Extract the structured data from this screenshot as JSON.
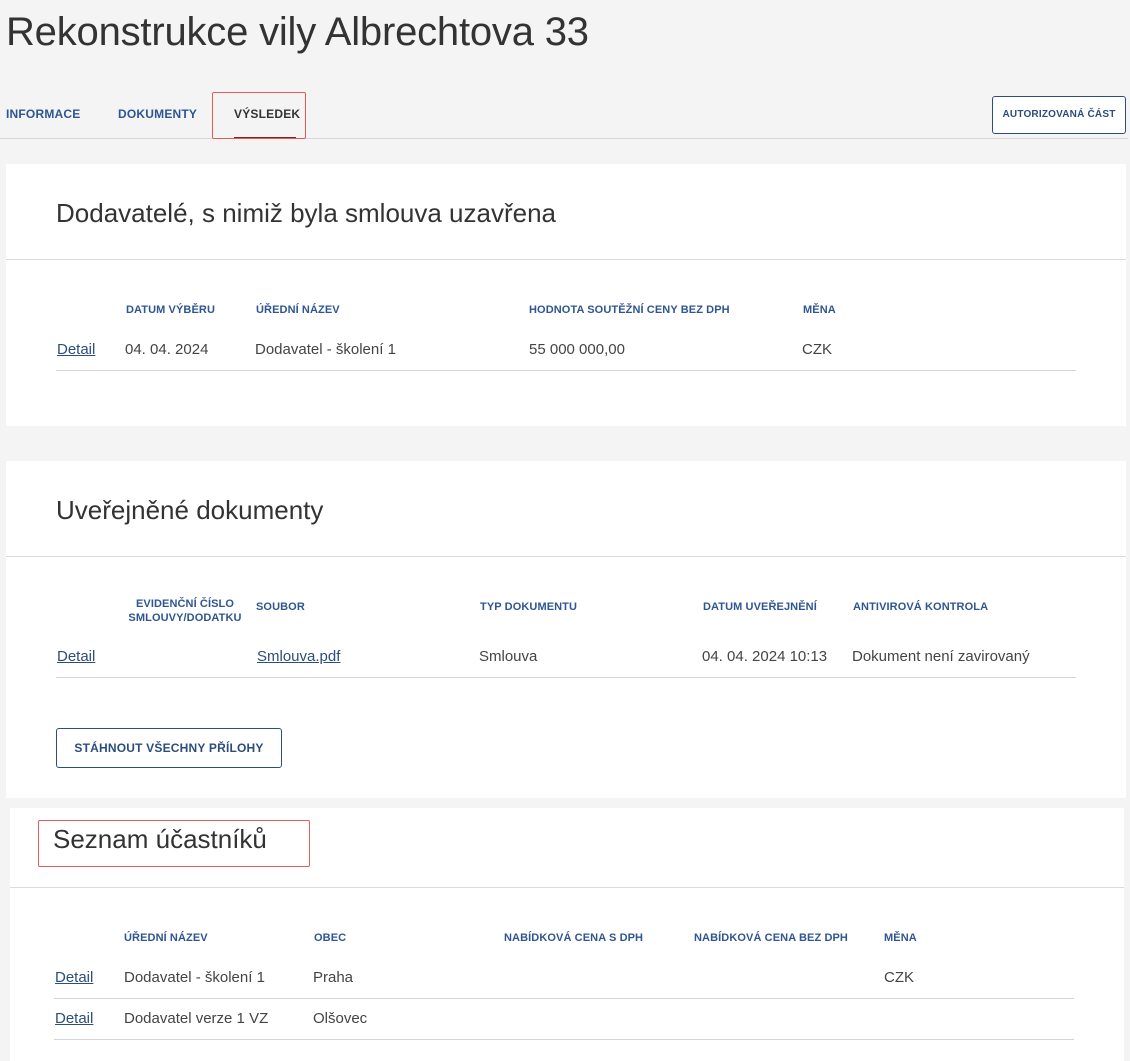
{
  "page": {
    "title": "Rekonstrukce vily Albrechtova 33"
  },
  "tabs": [
    {
      "label": "INFORMACE"
    },
    {
      "label": "DOKUMENTY"
    },
    {
      "label": "VÝSLEDEK"
    }
  ],
  "header": {
    "auth_button": "AUTORIZOVANÁ ČÁST"
  },
  "suppliers": {
    "title": "Dodavatelé, s nimiž byla smlouva uzavřena",
    "columns": [
      "DATUM VÝBĚRU",
      "ÚŘEDNÍ NÁZEV",
      "HODNOTA SOUTĚŽNÍ CENY BEZ DPH",
      "MĚNA"
    ],
    "rows": [
      {
        "detail": "Detail",
        "date": "04. 04. 2024",
        "name": "Dodavatel - školení 1",
        "value": "55 000 000,00",
        "currency": "CZK"
      }
    ]
  },
  "documents": {
    "title": "Uveřejněné dokumenty",
    "columns": [
      "EVIDENČNÍ ČÍSLO SMLOUVY/DODATKU",
      "SOUBOR",
      "TYP DOKUMENTU",
      "DATUM UVEŘEJNĚNÍ",
      "ANTIVIROVÁ KONTROLA"
    ],
    "rows": [
      {
        "detail": "Detail",
        "number": "",
        "file": "Smlouva.pdf",
        "type": "Smlouva",
        "published": "04. 04. 2024 10:13",
        "antivirus": "Dokument není zavirovaný"
      }
    ],
    "download_button": "STÁHNOUT VŠECHNY PŘÍLOHY"
  },
  "participants": {
    "title": "Seznam účastníků",
    "columns": [
      "ÚŘEDNÍ NÁZEV",
      "OBEC",
      "NABÍDKOVÁ CENA S DPH",
      "NABÍDKOVÁ CENA BEZ DPH",
      "MĚNA"
    ],
    "rows": [
      {
        "detail": "Detail",
        "name": "Dodavatel - školení 1",
        "city": "Praha",
        "price_vat": "",
        "price_novat": "",
        "currency": "CZK"
      },
      {
        "detail": "Detail",
        "name": "Dodavatel verze 1 VZ",
        "city": "Olšovec",
        "price_vat": "",
        "price_novat": "",
        "currency": ""
      }
    ]
  }
}
